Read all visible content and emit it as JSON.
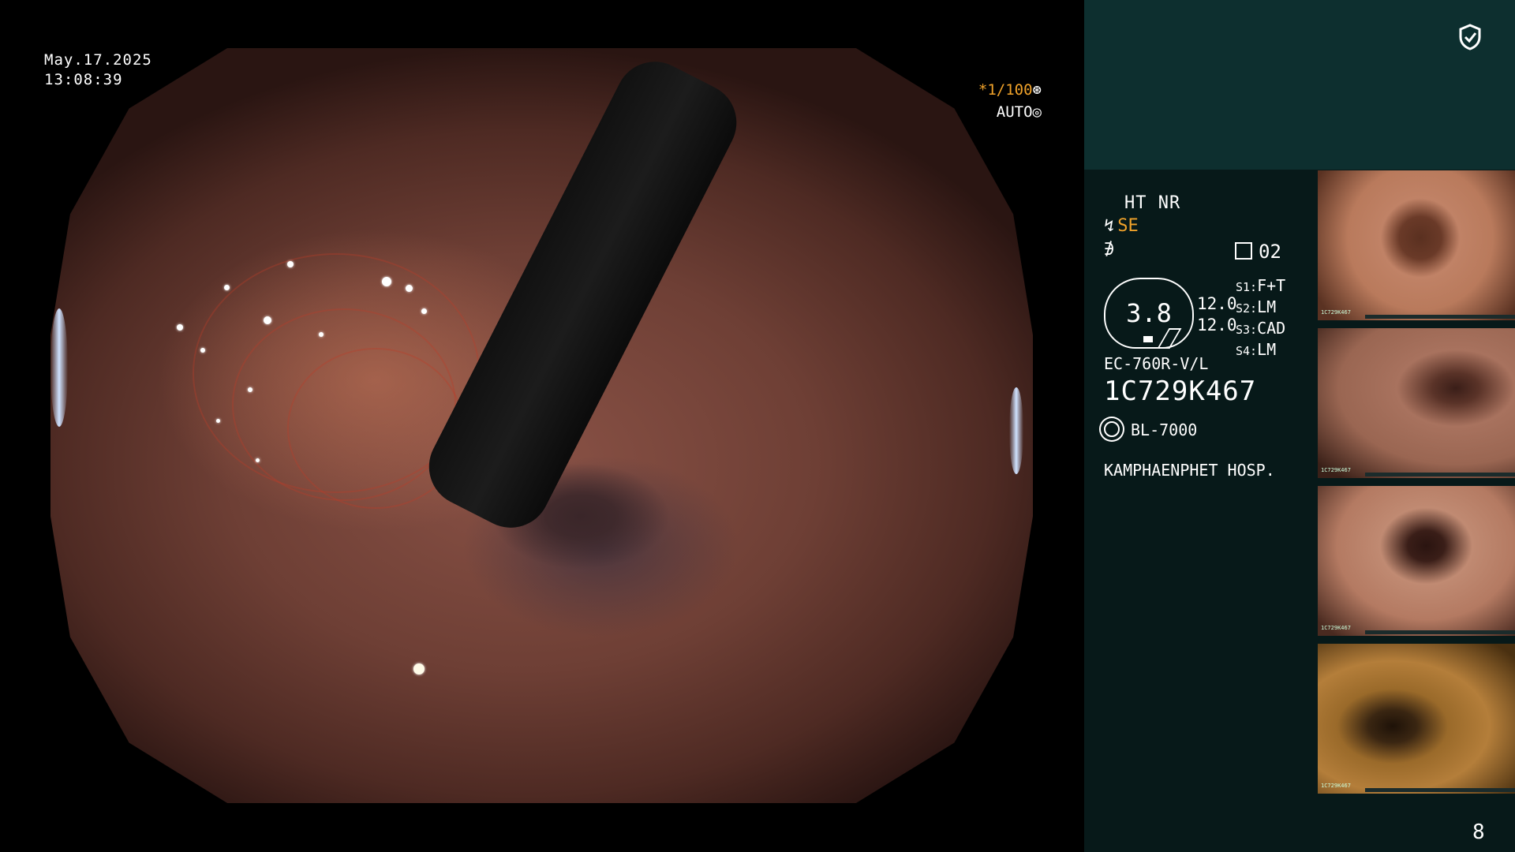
{
  "osd": {
    "date": "May.17.2025",
    "time": "13:08:39",
    "shutter": "*1/100",
    "exposure": "AUTO"
  },
  "panel": {
    "mode": "HT NR",
    "se_label": "SE",
    "sequence_num": "02",
    "gauge_value": "3.8",
    "gauge_sub1": "12.0",
    "gauge_sub2": "12.0",
    "s_settings": [
      {
        "key": "S1:",
        "value": "F+T"
      },
      {
        "key": "S2:",
        "value": "LM"
      },
      {
        "key": "S3:",
        "value": "CAD"
      },
      {
        "key": "S4:",
        "value": "LM"
      }
    ],
    "scope_model": "EC-760R-V/L",
    "serial": "1C729K467",
    "light_source": "BL-7000",
    "hospital": "KAMPHAENPHET HOSP.",
    "page_number": "8"
  },
  "thumbnails": [
    {
      "label": "1C729K467",
      "tint": "#b07a5a"
    },
    {
      "label": "1C729K467",
      "tint": "#9a6a55"
    },
    {
      "label": "1C729K467",
      "tint": "#b0806a"
    },
    {
      "label": "1C729K467",
      "tint": "#a0742e"
    }
  ],
  "icons": {
    "shield": "shield-check-icon",
    "light": "sun-icon",
    "shutter": "aperture-icon",
    "auto": "iris-icon"
  }
}
